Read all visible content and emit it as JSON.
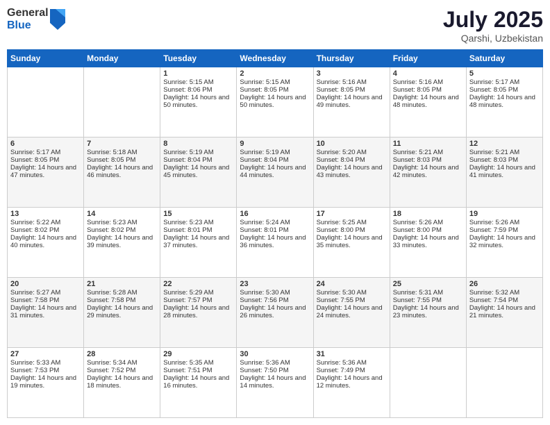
{
  "header": {
    "logo_general": "General",
    "logo_blue": "Blue",
    "month_year": "July 2025",
    "location": "Qarshi, Uzbekistan"
  },
  "days_of_week": [
    "Sunday",
    "Monday",
    "Tuesday",
    "Wednesday",
    "Thursday",
    "Friday",
    "Saturday"
  ],
  "weeks": [
    {
      "days": [
        {
          "num": "",
          "sunrise": "",
          "sunset": "",
          "daylight": ""
        },
        {
          "num": "",
          "sunrise": "",
          "sunset": "",
          "daylight": ""
        },
        {
          "num": "1",
          "sunrise": "Sunrise: 5:15 AM",
          "sunset": "Sunset: 8:06 PM",
          "daylight": "Daylight: 14 hours and 50 minutes."
        },
        {
          "num": "2",
          "sunrise": "Sunrise: 5:15 AM",
          "sunset": "Sunset: 8:05 PM",
          "daylight": "Daylight: 14 hours and 50 minutes."
        },
        {
          "num": "3",
          "sunrise": "Sunrise: 5:16 AM",
          "sunset": "Sunset: 8:05 PM",
          "daylight": "Daylight: 14 hours and 49 minutes."
        },
        {
          "num": "4",
          "sunrise": "Sunrise: 5:16 AM",
          "sunset": "Sunset: 8:05 PM",
          "daylight": "Daylight: 14 hours and 48 minutes."
        },
        {
          "num": "5",
          "sunrise": "Sunrise: 5:17 AM",
          "sunset": "Sunset: 8:05 PM",
          "daylight": "Daylight: 14 hours and 48 minutes."
        }
      ]
    },
    {
      "days": [
        {
          "num": "6",
          "sunrise": "Sunrise: 5:17 AM",
          "sunset": "Sunset: 8:05 PM",
          "daylight": "Daylight: 14 hours and 47 minutes."
        },
        {
          "num": "7",
          "sunrise": "Sunrise: 5:18 AM",
          "sunset": "Sunset: 8:05 PM",
          "daylight": "Daylight: 14 hours and 46 minutes."
        },
        {
          "num": "8",
          "sunrise": "Sunrise: 5:19 AM",
          "sunset": "Sunset: 8:04 PM",
          "daylight": "Daylight: 14 hours and 45 minutes."
        },
        {
          "num": "9",
          "sunrise": "Sunrise: 5:19 AM",
          "sunset": "Sunset: 8:04 PM",
          "daylight": "Daylight: 14 hours and 44 minutes."
        },
        {
          "num": "10",
          "sunrise": "Sunrise: 5:20 AM",
          "sunset": "Sunset: 8:04 PM",
          "daylight": "Daylight: 14 hours and 43 minutes."
        },
        {
          "num": "11",
          "sunrise": "Sunrise: 5:21 AM",
          "sunset": "Sunset: 8:03 PM",
          "daylight": "Daylight: 14 hours and 42 minutes."
        },
        {
          "num": "12",
          "sunrise": "Sunrise: 5:21 AM",
          "sunset": "Sunset: 8:03 PM",
          "daylight": "Daylight: 14 hours and 41 minutes."
        }
      ]
    },
    {
      "days": [
        {
          "num": "13",
          "sunrise": "Sunrise: 5:22 AM",
          "sunset": "Sunset: 8:02 PM",
          "daylight": "Daylight: 14 hours and 40 minutes."
        },
        {
          "num": "14",
          "sunrise": "Sunrise: 5:23 AM",
          "sunset": "Sunset: 8:02 PM",
          "daylight": "Daylight: 14 hours and 39 minutes."
        },
        {
          "num": "15",
          "sunrise": "Sunrise: 5:23 AM",
          "sunset": "Sunset: 8:01 PM",
          "daylight": "Daylight: 14 hours and 37 minutes."
        },
        {
          "num": "16",
          "sunrise": "Sunrise: 5:24 AM",
          "sunset": "Sunset: 8:01 PM",
          "daylight": "Daylight: 14 hours and 36 minutes."
        },
        {
          "num": "17",
          "sunrise": "Sunrise: 5:25 AM",
          "sunset": "Sunset: 8:00 PM",
          "daylight": "Daylight: 14 hours and 35 minutes."
        },
        {
          "num": "18",
          "sunrise": "Sunrise: 5:26 AM",
          "sunset": "Sunset: 8:00 PM",
          "daylight": "Daylight: 14 hours and 33 minutes."
        },
        {
          "num": "19",
          "sunrise": "Sunrise: 5:26 AM",
          "sunset": "Sunset: 7:59 PM",
          "daylight": "Daylight: 14 hours and 32 minutes."
        }
      ]
    },
    {
      "days": [
        {
          "num": "20",
          "sunrise": "Sunrise: 5:27 AM",
          "sunset": "Sunset: 7:58 PM",
          "daylight": "Daylight: 14 hours and 31 minutes."
        },
        {
          "num": "21",
          "sunrise": "Sunrise: 5:28 AM",
          "sunset": "Sunset: 7:58 PM",
          "daylight": "Daylight: 14 hours and 29 minutes."
        },
        {
          "num": "22",
          "sunrise": "Sunrise: 5:29 AM",
          "sunset": "Sunset: 7:57 PM",
          "daylight": "Daylight: 14 hours and 28 minutes."
        },
        {
          "num": "23",
          "sunrise": "Sunrise: 5:30 AM",
          "sunset": "Sunset: 7:56 PM",
          "daylight": "Daylight: 14 hours and 26 minutes."
        },
        {
          "num": "24",
          "sunrise": "Sunrise: 5:30 AM",
          "sunset": "Sunset: 7:55 PM",
          "daylight": "Daylight: 14 hours and 24 minutes."
        },
        {
          "num": "25",
          "sunrise": "Sunrise: 5:31 AM",
          "sunset": "Sunset: 7:55 PM",
          "daylight": "Daylight: 14 hours and 23 minutes."
        },
        {
          "num": "26",
          "sunrise": "Sunrise: 5:32 AM",
          "sunset": "Sunset: 7:54 PM",
          "daylight": "Daylight: 14 hours and 21 minutes."
        }
      ]
    },
    {
      "days": [
        {
          "num": "27",
          "sunrise": "Sunrise: 5:33 AM",
          "sunset": "Sunset: 7:53 PM",
          "daylight": "Daylight: 14 hours and 19 minutes."
        },
        {
          "num": "28",
          "sunrise": "Sunrise: 5:34 AM",
          "sunset": "Sunset: 7:52 PM",
          "daylight": "Daylight: 14 hours and 18 minutes."
        },
        {
          "num": "29",
          "sunrise": "Sunrise: 5:35 AM",
          "sunset": "Sunset: 7:51 PM",
          "daylight": "Daylight: 14 hours and 16 minutes."
        },
        {
          "num": "30",
          "sunrise": "Sunrise: 5:36 AM",
          "sunset": "Sunset: 7:50 PM",
          "daylight": "Daylight: 14 hours and 14 minutes."
        },
        {
          "num": "31",
          "sunrise": "Sunrise: 5:36 AM",
          "sunset": "Sunset: 7:49 PM",
          "daylight": "Daylight: 14 hours and 12 minutes."
        },
        {
          "num": "",
          "sunrise": "",
          "sunset": "",
          "daylight": ""
        },
        {
          "num": "",
          "sunrise": "",
          "sunset": "",
          "daylight": ""
        }
      ]
    }
  ]
}
